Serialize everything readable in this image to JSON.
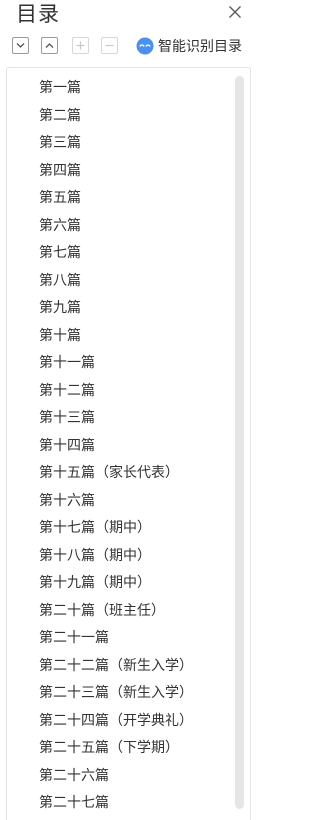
{
  "panel": {
    "title": "目录"
  },
  "toolbar": {
    "smart_label": "智能识别目录"
  },
  "icons": {
    "close": "close-icon",
    "expand": "chevron-down-icon",
    "collapse": "chevron-up-icon",
    "plus": "plus-icon",
    "minus": "minus-icon",
    "smart": "smart-recognize-icon"
  },
  "colors": {
    "accent": "#4a90f0",
    "text": "#333333",
    "border": "#e3e3e3",
    "scrollbar": "#e5e5e5"
  },
  "toc": {
    "items": [
      "第一篇",
      "第二篇",
      "第三篇",
      "第四篇",
      "第五篇",
      "第六篇",
      "第七篇",
      "第八篇",
      "第九篇",
      "第十篇",
      "第十一篇",
      "第十二篇",
      "第十三篇",
      "第十四篇",
      "第十五篇（家长代表）",
      "第十六篇",
      "第十七篇（期中）",
      "第十八篇（期中）",
      "第十九篇（期中）",
      "第二十篇（班主任）",
      "第二十一篇",
      "第二十二篇（新生入学）",
      "第二十三篇（新生入学）",
      "第二十四篇（开学典礼）",
      "第二十五篇（下学期）",
      "第二十六篇",
      "第二十七篇"
    ]
  }
}
